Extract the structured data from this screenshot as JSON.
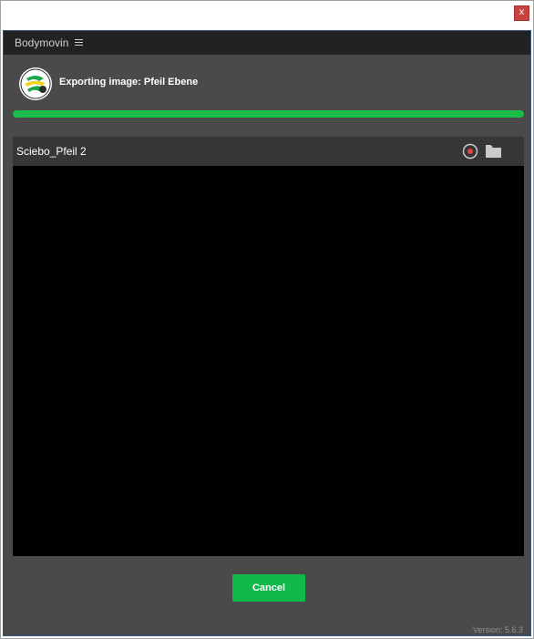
{
  "window": {
    "close_glyph": "x"
  },
  "panel": {
    "title": "Bodymovin",
    "menu_icon": "hamburger-menu-icon"
  },
  "export": {
    "status": "Exporting image: Pfeil Ebene",
    "progress_percent": 100
  },
  "composition": {
    "name": "Sciebo_Pfeil 2",
    "target_icon": "render-target-icon",
    "folder_icon": "folder-icon"
  },
  "actions": {
    "cancel_label": "Cancel"
  },
  "footer": {
    "version": "Version: 5.6.3"
  },
  "colors": {
    "panel_bg": "#4a4a4a",
    "header_bg": "#222222",
    "accent_green": "#11b84a",
    "target_red": "#e0483c",
    "close_red": "#c8433f"
  }
}
